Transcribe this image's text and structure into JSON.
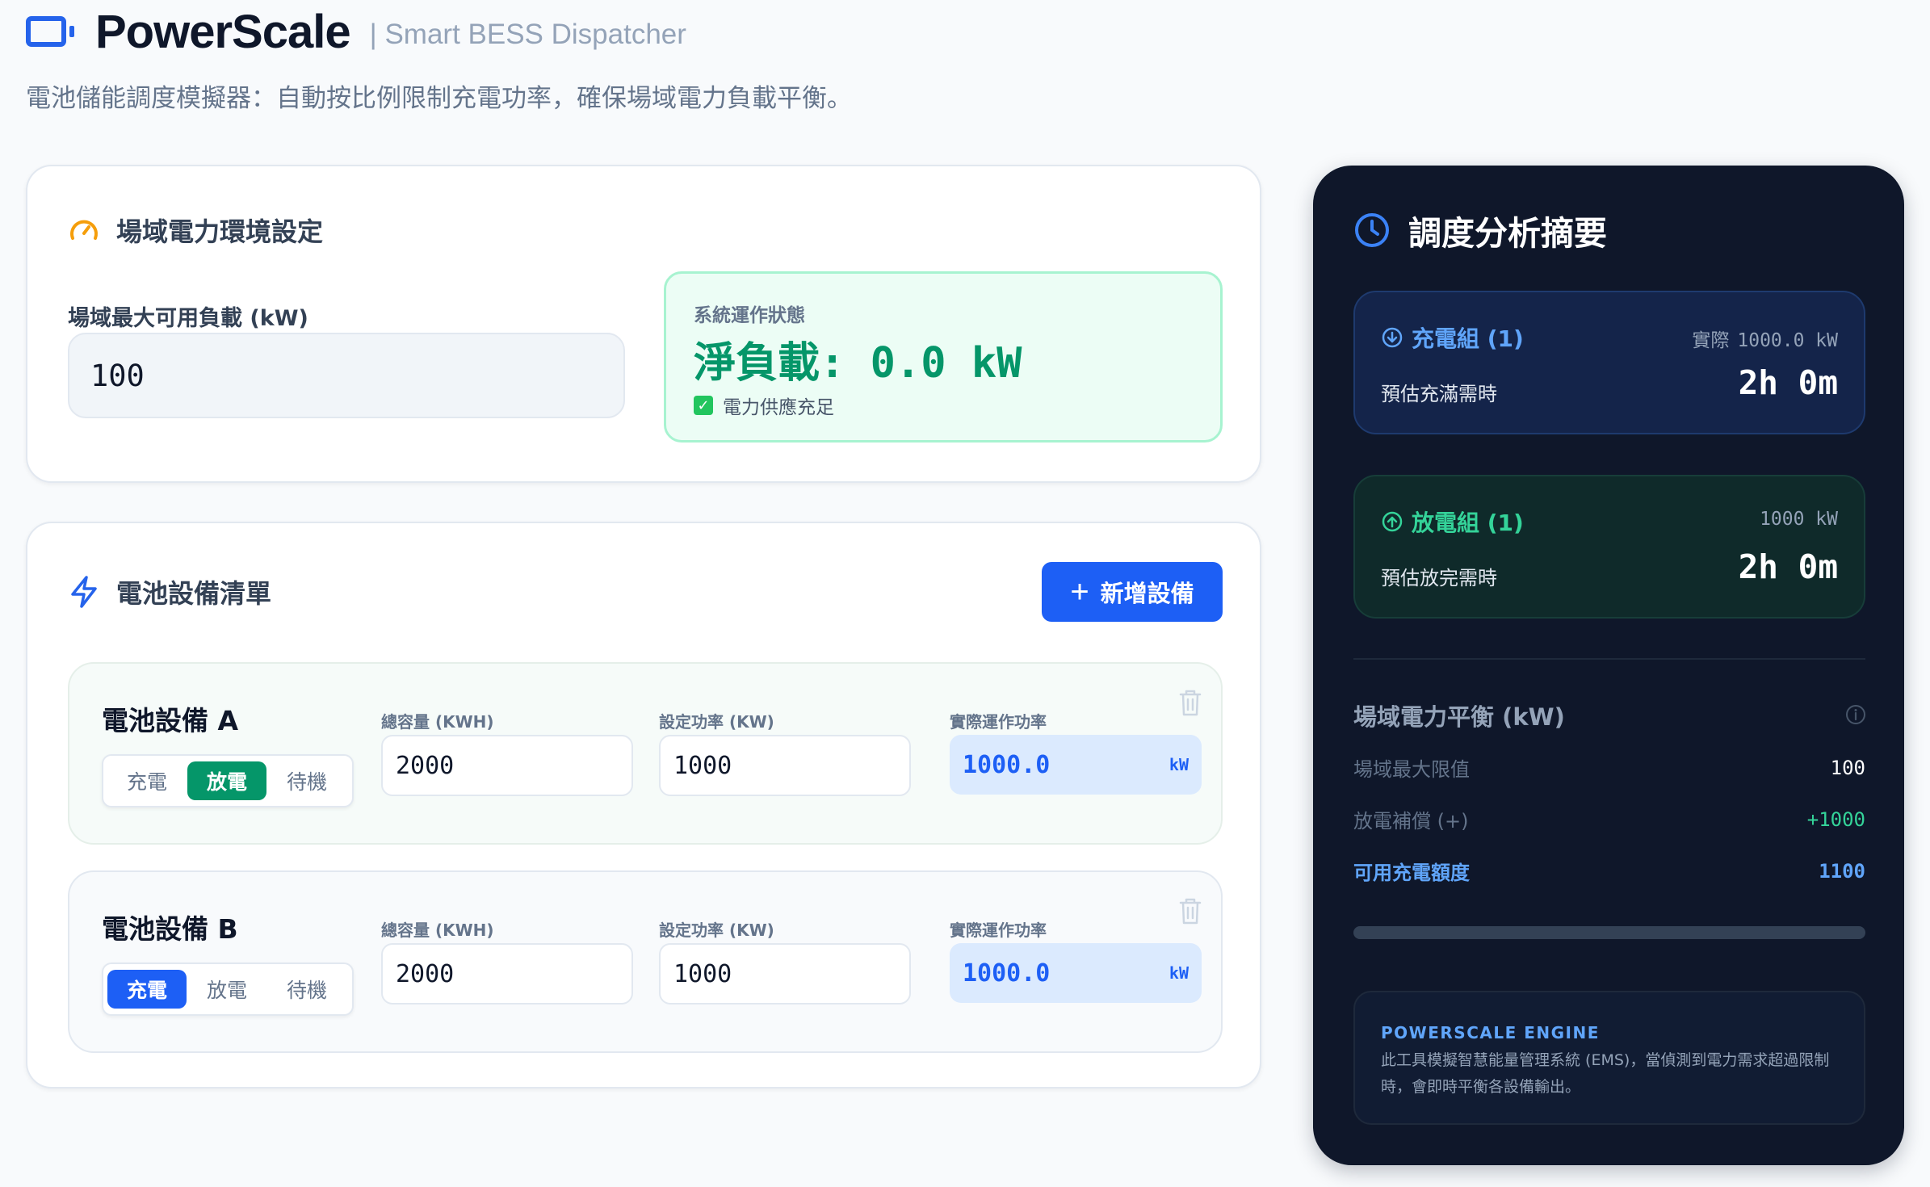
{
  "app": {
    "title": "PowerScale",
    "subtitle": "| Smart BESS Dispatcher",
    "description": "電池儲能調度模擬器：自動按比例限制充電功率，確保場域電力負載平衡。"
  },
  "site_settings": {
    "title": "場域電力環境設定",
    "max_load_label": "場域最大可用負載 (kW)",
    "max_load_value": "100",
    "status": {
      "label": "系統運作狀態",
      "value": "淨負載: 0.0 kW",
      "note": "電力供應充足"
    }
  },
  "battery_list": {
    "title": "電池設備清單",
    "add_button": "新增設備",
    "column_labels": {
      "capacity": "總容量 (KWH)",
      "set_power": "設定功率 (KW)",
      "actual_power": "實際運作功率"
    },
    "mode_options": [
      "充電",
      "放電",
      "待機"
    ],
    "devices": [
      {
        "name": "電池設備 A",
        "mode": "放電",
        "capacity": "2000",
        "set_power": "1000",
        "actual_power": "1000.0",
        "unit": "kW"
      },
      {
        "name": "電池設備 B",
        "mode": "充電",
        "capacity": "2000",
        "set_power": "1000",
        "actual_power": "1000.0",
        "unit": "kW"
      }
    ]
  },
  "summary": {
    "title": "調度分析摘要",
    "charge_group": {
      "title": "充電組 (1)",
      "right_label": "實際",
      "right_value": "1000.0 kW",
      "eta_label": "預估充滿需時",
      "eta_value": "2h 0m"
    },
    "discharge_group": {
      "title": "放電組 (1)",
      "right_value": "1000 kW",
      "eta_label": "預估放完需時",
      "eta_value": "2h 0m"
    },
    "balance": {
      "title": "場域電力平衡 (kW)",
      "rows": [
        {
          "label": "場域最大限值",
          "value": "100"
        },
        {
          "label": "放電補償 (+)",
          "value": "+1000"
        },
        {
          "label": "可用充電額度",
          "value": "1100"
        }
      ]
    },
    "engine": {
      "title": "POWERSCALE ENGINE",
      "text": "此工具模擬智慧能量管理系統 (EMS)，當偵測到電力需求超過限制時，會即時平衡各設備輸出。"
    }
  },
  "colors": {
    "accent": "#1d5ff5",
    "discharge": "#059669",
    "dark_panel": "#0f172a"
  }
}
